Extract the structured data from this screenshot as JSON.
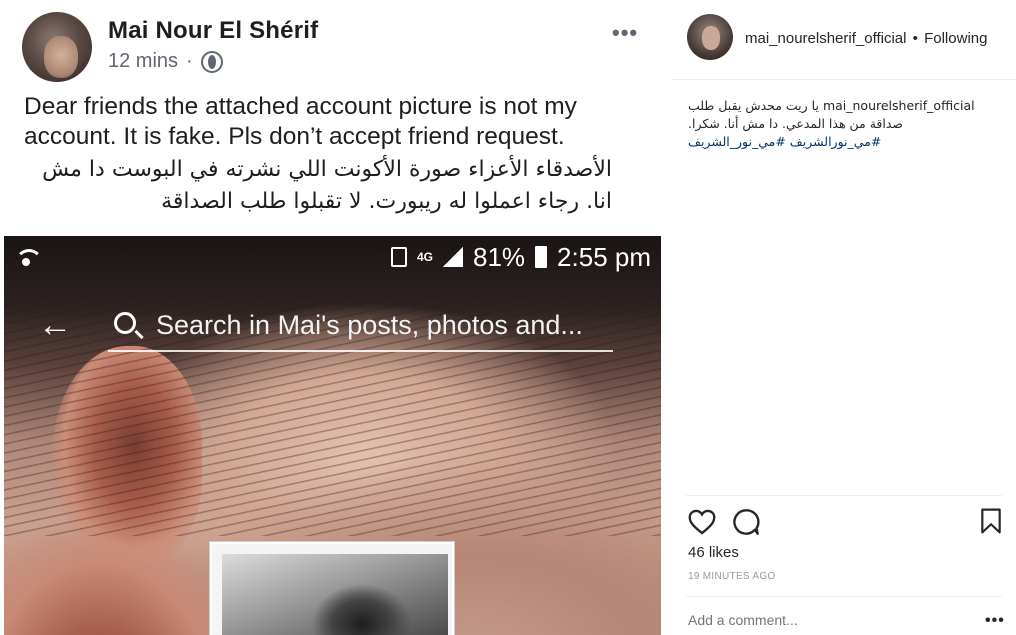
{
  "fb_post": {
    "author": "Mai Nour El Shérif",
    "time": "12 mins",
    "privacy_icon": "globe-icon",
    "more_icon": "•••",
    "text_en": "Dear friends the attached account picture is not my account. It is fake. Pls don’t accept friend request.",
    "text_ar": "الأصدقاء الأعزاء صورة الأكونت اللي نشرته  في البوست دا مش انا. رجاء اعملوا له ريبورت. لا تقبلوا طلب الصداقة"
  },
  "phone_screenshot": {
    "status": {
      "network": "4G",
      "battery": "81%",
      "time": "2:55 pm"
    },
    "back_icon": "←",
    "search_placeholder": "Search in Mai's posts, photos and..."
  },
  "instagram": {
    "username": "mai_nourelsherif_official",
    "separator": "•",
    "follow_status": "Following",
    "caption_user": "mai_nourelsherif_official",
    "caption_text": "يا ريت محدش يقبل طلب صداقة من هذا المدعي. دا مش أنا. شكرا.",
    "hashtag_1": "#مي_نورالشريف",
    "hashtag_2": "#مي_نور_الشريف",
    "likes": "46 likes",
    "time_ago": "19 MINUTES AGO",
    "comment_placeholder": "Add a comment...",
    "comment_more": "•••"
  },
  "icons": {
    "heart": "heart-icon",
    "comment": "comment-icon",
    "bookmark": "bookmark-icon",
    "wifi": "wifi-icon",
    "search": "search-icon"
  }
}
